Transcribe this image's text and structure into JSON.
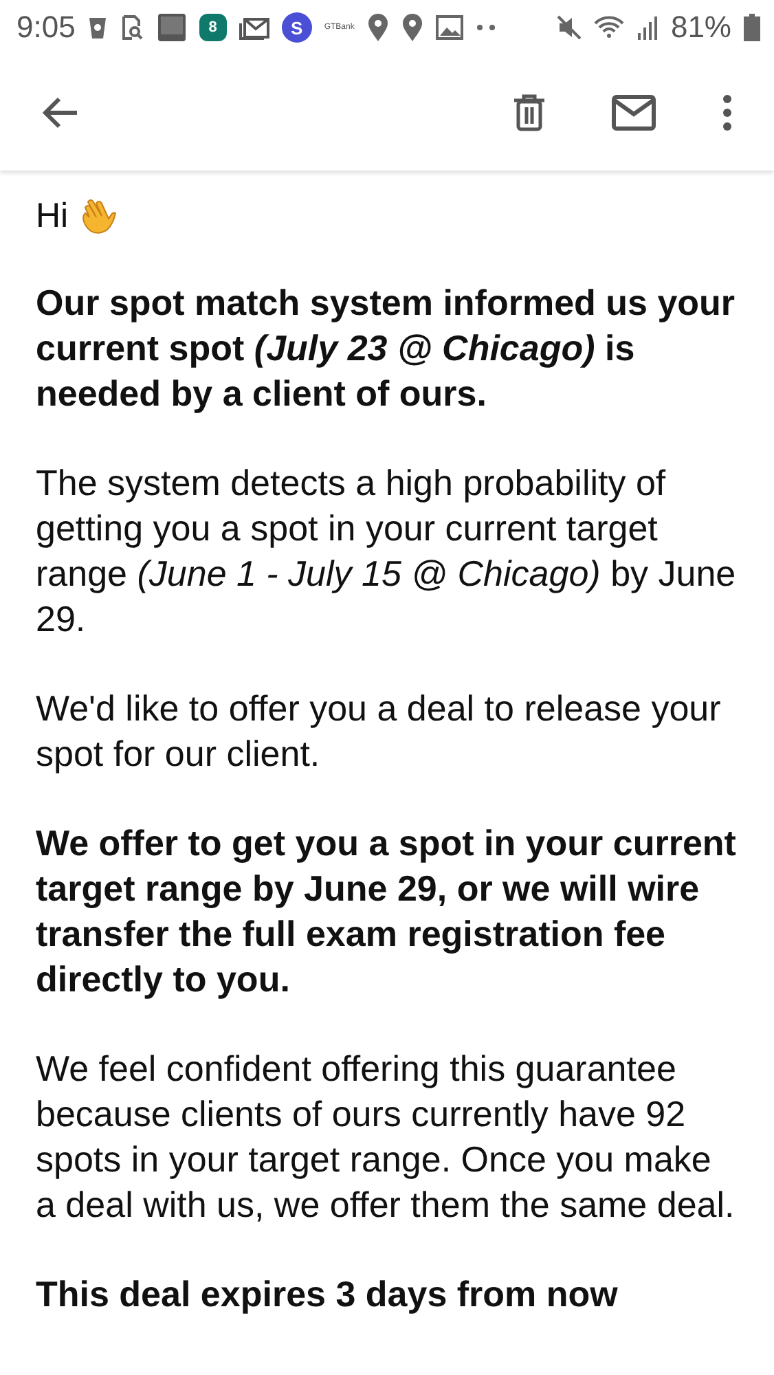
{
  "status_bar": {
    "time": "9:05",
    "calendar_day": "8",
    "app_letter": "S",
    "bank_label": "GTBank",
    "battery": "81%"
  },
  "email": {
    "greeting": "Hi",
    "paragraphs": [
      {
        "kind": "bold",
        "text": "Our spot match system informed us your current spot *(July 23 @ Chicago)* is needed by a client of ours."
      },
      {
        "kind": "normal",
        "text": "The system detects a high probability of getting you a spot in your current target range *(June 1 - July 15 @ Chicago)* by June 29."
      },
      {
        "kind": "normal",
        "text": "We'd like to offer you a deal to release your spot for our client."
      },
      {
        "kind": "bold",
        "text": "We offer to get you a spot in your current target range by June 29, or we will wire transfer the full exam registration fee directly to you."
      },
      {
        "kind": "normal",
        "text": "We feel confident offering this guarantee because clients of ours currently have 92 spots in your target range. Once you make a deal with us, we offer them the same deal."
      },
      {
        "kind": "bold",
        "text": "This deal expires 3 days from now"
      }
    ]
  }
}
